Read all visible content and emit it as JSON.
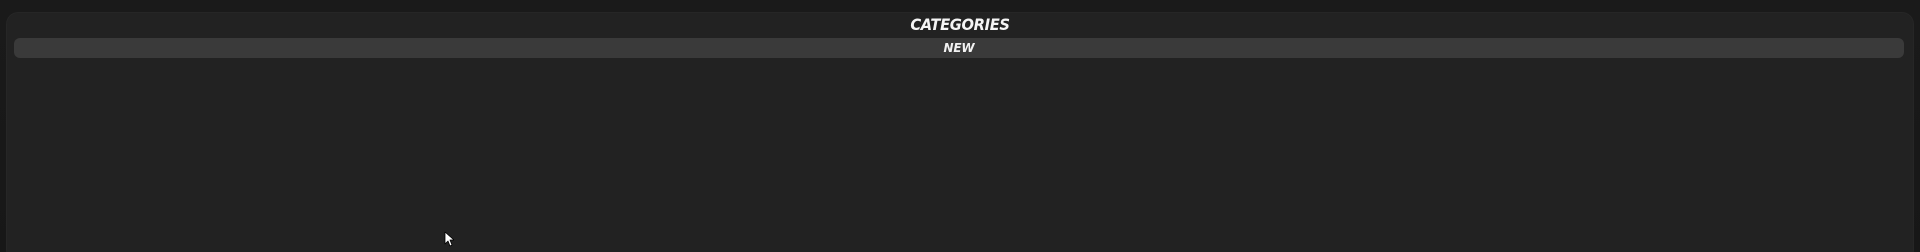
{
  "panel": {
    "title": "CATEGORIES",
    "categories": [
      {
        "label": "NEW"
      }
    ]
  },
  "colors": {
    "page_background": "#161616",
    "panel_background": "#222222",
    "category_background": "#3a3a3a",
    "text": "#f5f5f5"
  },
  "icons": {
    "cursor": "mouse-pointer-icon"
  }
}
